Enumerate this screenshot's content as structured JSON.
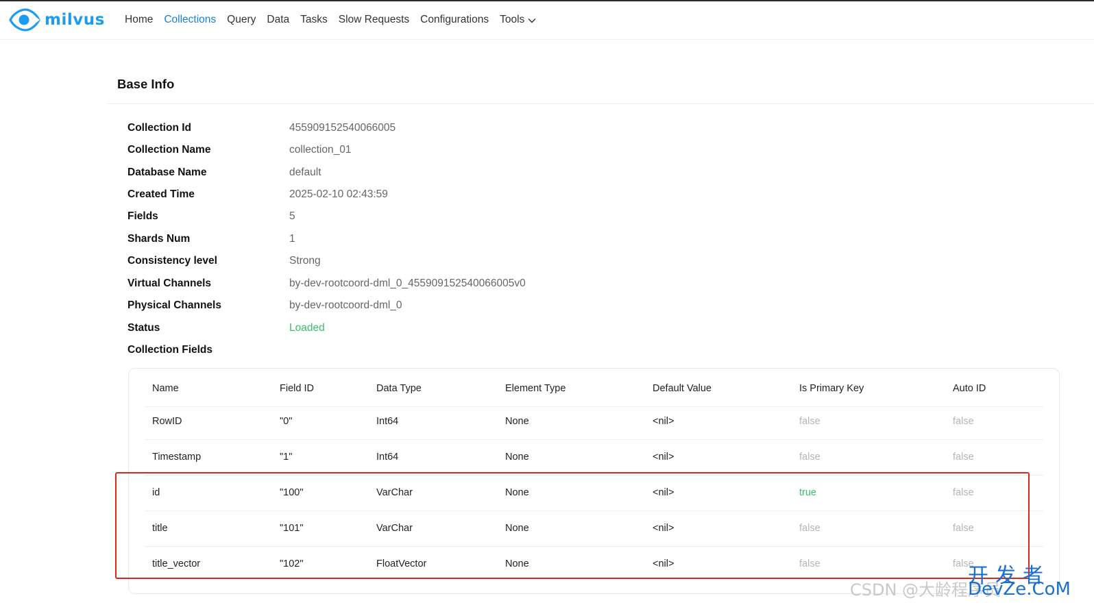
{
  "app": {
    "brand": "milvus"
  },
  "nav": {
    "items": [
      "Home",
      "Collections",
      "Query",
      "Data",
      "Tasks",
      "Slow Requests",
      "Configurations"
    ],
    "active": "Collections",
    "tools_label": "Tools"
  },
  "section": {
    "title": "Base Info"
  },
  "info": [
    {
      "label": "Collection Id",
      "value": "455909152540066005"
    },
    {
      "label": "Collection Name",
      "value": "collection_01"
    },
    {
      "label": "Database Name",
      "value": "default"
    },
    {
      "label": "Created Time",
      "value": "2025-02-10 02:43:59"
    },
    {
      "label": "Fields",
      "value": "5"
    },
    {
      "label": "Shards Num",
      "value": "1"
    },
    {
      "label": "Consistency level",
      "value": "Strong"
    },
    {
      "label": "Virtual Channels",
      "value": "by-dev-rootcoord-dml_0_455909152540066005v0"
    },
    {
      "label": "Physical Channels",
      "value": "by-dev-rootcoord-dml_0"
    },
    {
      "label": "Status",
      "value": "Loaded"
    },
    {
      "label": "Collection Fields",
      "value": ""
    }
  ],
  "fields_table": {
    "columns": [
      "Name",
      "Field ID",
      "Data Type",
      "Element Type",
      "Default Value",
      "Is Primary Key",
      "Auto ID"
    ],
    "rows": [
      [
        "RowID",
        "\"0\"",
        "Int64",
        "None",
        "<nil>",
        "false",
        "false"
      ],
      [
        "Timestamp",
        "\"1\"",
        "Int64",
        "None",
        "<nil>",
        "false",
        "false"
      ],
      [
        "id",
        "\"100\"",
        "VarChar",
        "None",
        "<nil>",
        "true",
        "false"
      ],
      [
        "title",
        "\"101\"",
        "VarChar",
        "None",
        "<nil>",
        "false",
        "false"
      ],
      [
        "title_vector",
        "\"102\"",
        "FloatVector",
        "None",
        "<nil>",
        "false",
        "false"
      ]
    ]
  },
  "watermark": {
    "csdn": "CSDN @大龄程序员",
    "zh": "开发者",
    "en": "DevZe.CoM"
  },
  "colors": {
    "accent": "#1a7fd6",
    "brand": "#1a9cf0",
    "loaded": "#39c06a",
    "highlight": "#e52222"
  }
}
